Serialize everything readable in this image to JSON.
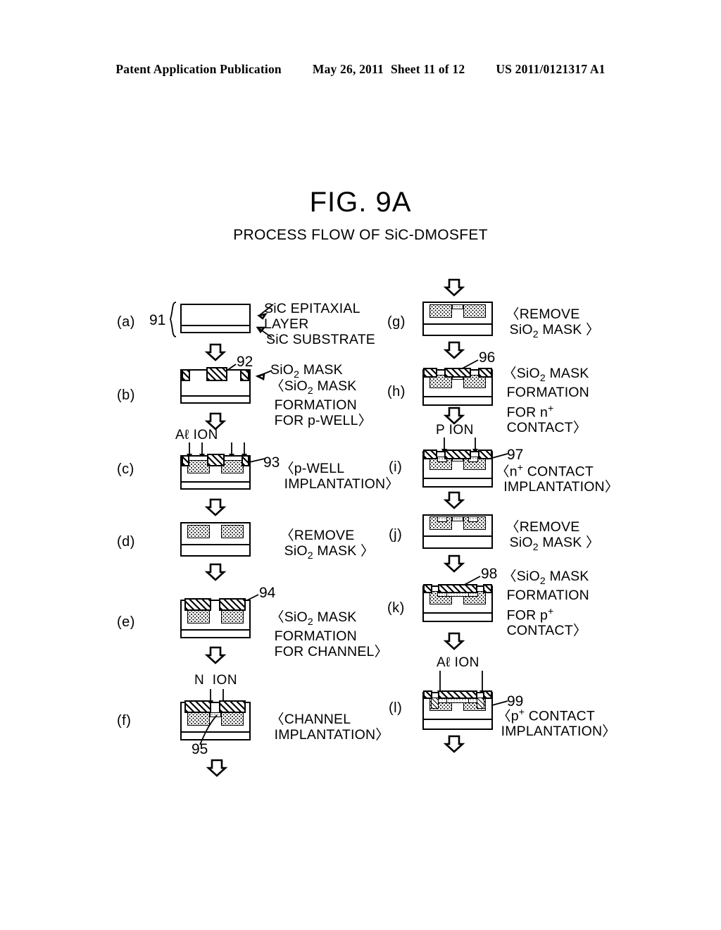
{
  "header": {
    "publication": "Patent Application Publication",
    "date": "May 26, 2011",
    "sheet": "Sheet 11 of 12",
    "docnumber": "US 2011/0121317 A1"
  },
  "figure": {
    "number": "FIG. 9A",
    "subtitle": "PROCESS FLOW OF SiC-DMOSFET"
  },
  "annotations": {
    "sic_epitaxial_layer": "SiC EPITAXIAL\nLAYER",
    "sic_substrate": "SiC SUBSTRATE",
    "sio2_mask": "SiO2 MASK"
  },
  "steps": [
    {
      "id": "a",
      "label": "(a)",
      "refnum": "91",
      "caption": "",
      "column": "left"
    },
    {
      "id": "b",
      "label": "(b)",
      "refnum": "92",
      "caption": "〈SiO2 MASK\n FORMATION\n FOR p-WELL〉",
      "column": "left"
    },
    {
      "id": "c",
      "label": "(c)",
      "refnum": "93",
      "ion": "Aℓ ION",
      "caption": "〈p-WELL\n IMPLANTATION〉",
      "column": "left"
    },
    {
      "id": "d",
      "label": "(d)",
      "refnum": "",
      "caption": "〈REMOVE\n SiO2 MASK 〉",
      "column": "left"
    },
    {
      "id": "e",
      "label": "(e)",
      "refnum": "94",
      "caption": "〈SiO2 MASK\n FORMATION\n FOR CHANNEL〉",
      "column": "left"
    },
    {
      "id": "f",
      "label": "(f)",
      "refnum": "95",
      "ion": "N  ION",
      "caption": "〈CHANNEL\n IMPLANTATION〉",
      "column": "left"
    },
    {
      "id": "g",
      "label": "(g)",
      "refnum": "",
      "caption": "〈REMOVE\n SiO2 MASK 〉",
      "column": "right"
    },
    {
      "id": "h",
      "label": "(h)",
      "refnum": "96",
      "caption": "〈SiO2 MASK\n FORMATION\n FOR n+\n CONTACT〉",
      "column": "right"
    },
    {
      "id": "i",
      "label": "(i)",
      "refnum": "97",
      "ion": "P ION",
      "caption": "〈n+ CONTACT\n  IMPLANTATION〉",
      "column": "right"
    },
    {
      "id": "j",
      "label": "(j)",
      "refnum": "",
      "caption": "〈REMOVE\n SiO2 MASK 〉",
      "column": "right"
    },
    {
      "id": "k",
      "label": "(k)",
      "refnum": "98",
      "caption": "〈SiO2 MASK\n FORMATION\n FOR p+\n CONTACT〉",
      "column": "right"
    },
    {
      "id": "l",
      "label": "(l)",
      "refnum": "99",
      "ion": "Aℓ ION",
      "caption": "〈p+ CONTACT\n IMPLANTATION〉",
      "column": "right"
    }
  ],
  "colors": {
    "ink": "#000000",
    "paper": "#ffffff"
  }
}
